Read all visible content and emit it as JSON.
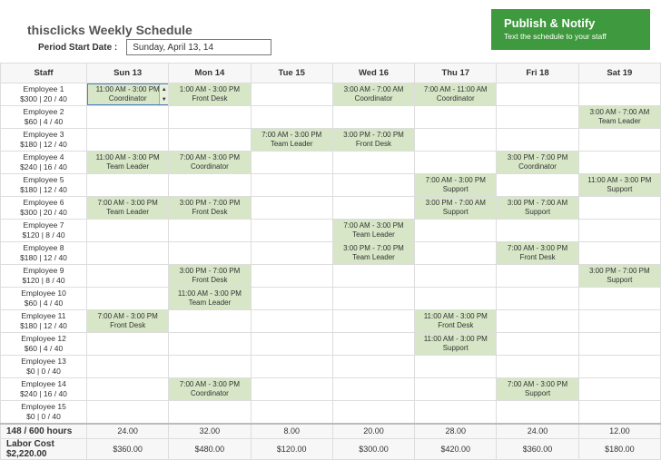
{
  "title": "thisclicks Weekly Schedule",
  "publish": {
    "title": "Publish & Notify",
    "sub": "Text the schedule to your staff"
  },
  "period": {
    "label": "Period Start Date :",
    "value": "Sunday, April 13, 14"
  },
  "headers": [
    "Staff",
    "Sun 13",
    "Mon 14",
    "Tue 15",
    "Wed 16",
    "Thu 17",
    "Fri 18",
    "Sat 19"
  ],
  "employees": [
    {
      "name": "Employee 1",
      "meta": "$300 | 20 / 40",
      "shifts": [
        {
          "time": "11:00 AM - 3:00 PM",
          "role": "Coordinator",
          "sel": true
        },
        {
          "time": "1:00 AM - 3:00 PM",
          "role": "Front Desk"
        },
        null,
        {
          "time": "3:00 AM - 7:00 AM",
          "role": "Coordinator"
        },
        {
          "time": "7:00 AM - 11:00 AM",
          "role": "Coordinator"
        },
        null,
        null
      ]
    },
    {
      "name": "Employee 2",
      "meta": "$60 | 4 / 40",
      "shifts": [
        null,
        null,
        null,
        null,
        null,
        null,
        {
          "time": "3:00 AM - 7:00 AM",
          "role": "Team Leader"
        }
      ]
    },
    {
      "name": "Employee 3",
      "meta": "$180 | 12 / 40",
      "shifts": [
        null,
        null,
        {
          "time": "7:00 AM - 3:00 PM",
          "role": "Team Leader"
        },
        {
          "time": "3:00 PM - 7:00 PM",
          "role": "Front Desk"
        },
        null,
        null,
        null
      ]
    },
    {
      "name": "Employee 4",
      "meta": "$240 | 16 / 40",
      "shifts": [
        {
          "time": "11:00 AM - 3:00 PM",
          "role": "Team Leader"
        },
        {
          "time": "7:00 AM - 3:00 PM",
          "role": "Coordinator"
        },
        null,
        null,
        null,
        {
          "time": "3:00 PM - 7:00 PM",
          "role": "Coordinator"
        },
        null
      ]
    },
    {
      "name": "Employee 5",
      "meta": "$180 | 12 / 40",
      "shifts": [
        null,
        null,
        null,
        null,
        {
          "time": "7:00 AM - 3:00 PM",
          "role": "Support"
        },
        null,
        {
          "time": "11:00 AM - 3:00 PM",
          "role": "Support"
        }
      ]
    },
    {
      "name": "Employee 6",
      "meta": "$300 | 20 / 40",
      "shifts": [
        {
          "time": "7:00 AM - 3:00 PM",
          "role": "Team Leader"
        },
        {
          "time": "3:00 PM - 7:00 PM",
          "role": "Front Desk"
        },
        null,
        null,
        {
          "time": "3:00 PM - 7:00 AM",
          "role": "Support"
        },
        {
          "time": "3:00 PM - 7:00 AM",
          "role": "Support"
        },
        null
      ]
    },
    {
      "name": "Employee 7",
      "meta": "$120 | 8 / 40",
      "shifts": [
        null,
        null,
        null,
        {
          "time": "7:00 AM - 3:00 PM",
          "role": "Team Leader"
        },
        null,
        null,
        null
      ]
    },
    {
      "name": "Employee 8",
      "meta": "$180 | 12 / 40",
      "shifts": [
        null,
        null,
        null,
        {
          "time": "3:00 PM - 7:00 PM",
          "role": "Team Leader"
        },
        null,
        {
          "time": "7:00 AM - 3:00 PM",
          "role": "Front Desk"
        },
        null
      ]
    },
    {
      "name": "Employee 9",
      "meta": "$120 | 8 / 40",
      "shifts": [
        null,
        {
          "time": "3:00 PM - 7:00 PM",
          "role": "Front Desk"
        },
        null,
        null,
        null,
        null,
        {
          "time": "3:00 PM - 7:00 PM",
          "role": "Support"
        }
      ]
    },
    {
      "name": "Employee 10",
      "meta": "$60 | 4 / 40",
      "shifts": [
        null,
        {
          "time": "11:00 AM - 3:00 PM",
          "role": "Team Leader"
        },
        null,
        null,
        null,
        null,
        null
      ]
    },
    {
      "name": "Employee 11",
      "meta": "$180 | 12 / 40",
      "shifts": [
        {
          "time": "7:00 AM - 3:00 PM",
          "role": "Front Desk"
        },
        null,
        null,
        null,
        {
          "time": "11:00 AM - 3:00 PM",
          "role": "Front Desk"
        },
        null,
        null
      ]
    },
    {
      "name": "Employee 12",
      "meta": "$60 | 4 / 40",
      "shifts": [
        null,
        null,
        null,
        null,
        {
          "time": "11:00 AM - 3:00 PM",
          "role": "Support"
        },
        null,
        null
      ]
    },
    {
      "name": "Employee 13",
      "meta": "$0 | 0 / 40",
      "shifts": [
        null,
        null,
        null,
        null,
        null,
        null,
        null
      ]
    },
    {
      "name": "Employee 14",
      "meta": "$240 | 16 / 40",
      "shifts": [
        null,
        {
          "time": "7:00 AM - 3:00 PM",
          "role": "Coordinator"
        },
        null,
        null,
        null,
        {
          "time": "7:00 AM - 3:00 PM",
          "role": "Support"
        },
        null
      ]
    },
    {
      "name": "Employee 15",
      "meta": "$0 | 0 / 40",
      "shifts": [
        null,
        null,
        null,
        null,
        null,
        null,
        null
      ]
    }
  ],
  "totals": {
    "hours_label": "148 / 600 hours",
    "hours": [
      "24.00",
      "32.00",
      "8.00",
      "20.00",
      "28.00",
      "24.00",
      "12.00"
    ],
    "cost_label": "Labor Cost $2,220.00",
    "cost": [
      "$360.00",
      "$480.00",
      "$120.00",
      "$300.00",
      "$420.00",
      "$360.00",
      "$180.00"
    ]
  }
}
